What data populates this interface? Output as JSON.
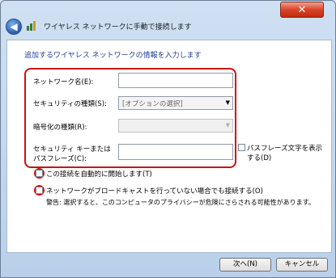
{
  "window": {
    "title": "ワイヤレス ネットワークに手動で接続します",
    "close_label": "✕"
  },
  "heading": "追加するワイヤレス ネットワークの情報を入力します",
  "fields": {
    "network_name_label": "ネットワーク名(E):",
    "network_name_value": "",
    "security_type_label": "セキュリティの種類(S):",
    "security_type_value": "[オプションの選択]",
    "encryption_type_label": "暗号化の種類(R):",
    "encryption_type_value": "",
    "security_key_label_line1": "セキュリティ キーまたは",
    "security_key_label_line2": "パスフレーズ(C):",
    "security_key_value": "",
    "show_passphrase_label_line1": "パスフレーズ文字を表示",
    "show_passphrase_label_line2": "する(D)"
  },
  "options": {
    "auto_connect_label": "この接続を自動的に開始します(T)",
    "connect_hidden_label": "ネットワークがブロードキャストを行っていない場合でも接続する(O)",
    "warning_text": "警告: 選択すると、このコンピュータのプライバシーが危険にさらされる可能性があります。"
  },
  "buttons": {
    "next_label": "次へ(N)",
    "cancel_label": "キャンセル"
  }
}
